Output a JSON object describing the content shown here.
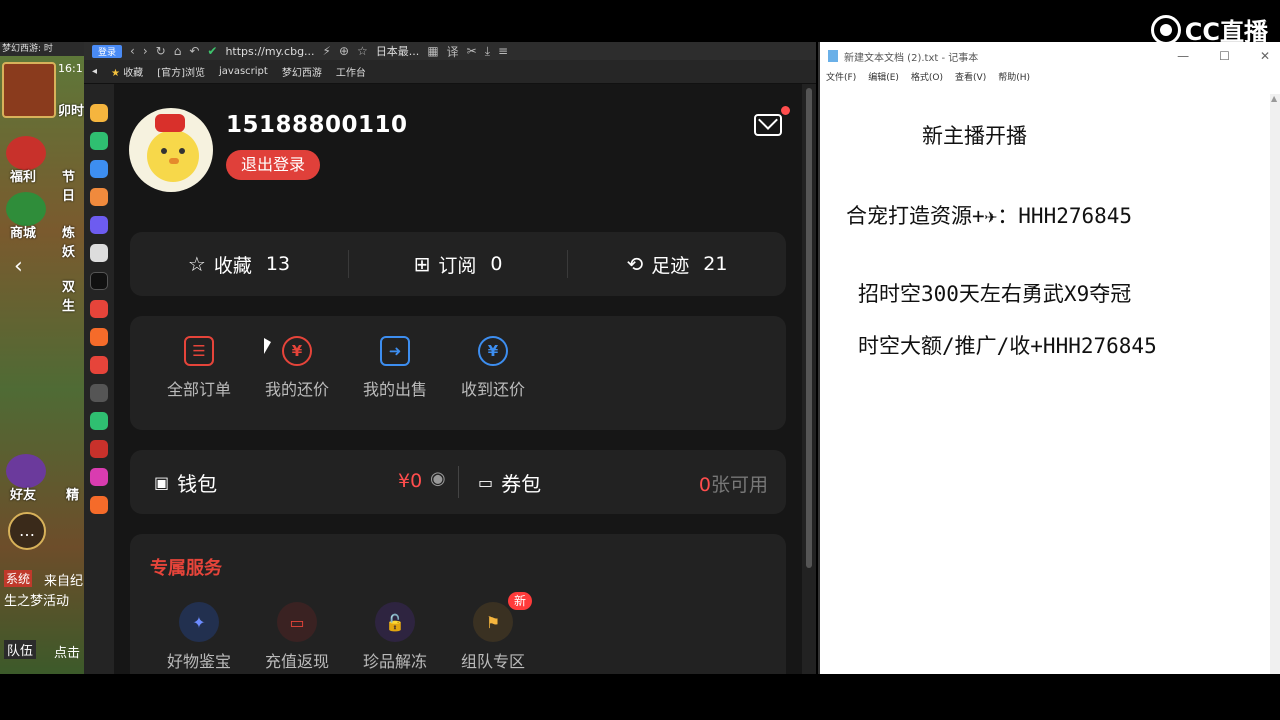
{
  "stream": {
    "logo_text": "CC直播"
  },
  "game": {
    "window_title": "梦幻西游: 时",
    "time": "16:1",
    "labels": [
      {
        "text": "卯时"
      },
      {
        "text": "福利"
      },
      {
        "text": "节日"
      },
      {
        "text": "商城"
      },
      {
        "text": "炼妖"
      },
      {
        "text": "双生"
      },
      {
        "text": "好友"
      },
      {
        "text": "精"
      }
    ],
    "system_chip": "系统",
    "system_text": "来自纪",
    "system_text2": "生之梦活动",
    "team_label": "队伍",
    "team_text": "点击"
  },
  "browser": {
    "login_badge": "登录",
    "url": "https://my.cbg...",
    "tab_text": "日本最...",
    "bookmarks": [
      "收藏",
      "[官方]浏览",
      "javascript",
      "梦幻西游",
      "工作台"
    ],
    "page": {
      "username": "15188800110",
      "logout_label": "退出登录",
      "stats": [
        {
          "label": "收藏",
          "count": "13",
          "icon": "star-icon"
        },
        {
          "label": "订阅",
          "count": "0",
          "icon": "subscribe-icon"
        },
        {
          "label": "足迹",
          "count": "21",
          "icon": "footprint-icon"
        }
      ],
      "orders": [
        {
          "label": "全部订单",
          "glyph": "☰",
          "color": "#e6443a"
        },
        {
          "label": "我的还价",
          "glyph": "¥",
          "color": "#e6443a"
        },
        {
          "label": "我的出售",
          "glyph": "➜",
          "color": "#3d8ef0"
        },
        {
          "label": "收到还价",
          "glyph": "¥",
          "color": "#3d8ef0"
        }
      ],
      "wallet": {
        "label": "钱包",
        "amount": "¥0",
        "coupon_label": "券包",
        "coupon_zero": "0",
        "coupon_text": "张可用"
      },
      "services_title": "专属服务",
      "services": [
        {
          "label": "好物鉴宝",
          "bg": "#22304f",
          "fg": "#6d8cff",
          "glyph": "✦"
        },
        {
          "label": "充值返现",
          "bg": "#3a2222",
          "fg": "#e6443a",
          "glyph": "▭"
        },
        {
          "label": "珍品解冻",
          "bg": "#2e2440",
          "fg": "#9b6bf0",
          "glyph": "🔓"
        },
        {
          "label": "组队专区",
          "bg": "#3a3122",
          "fg": "#f5b53e",
          "glyph": "⚑",
          "badge": "新"
        }
      ]
    }
  },
  "notepad": {
    "title": "新建文本文档 (2).txt - 记事本",
    "menu": [
      "文件(F)",
      "编辑(E)",
      "格式(O)",
      "查看(V)",
      "帮助(H)"
    ],
    "lines": [
      {
        "text": "新主播开播"
      },
      {
        "text": "合宠打造资源+✈：HHH276845"
      },
      {
        "text": "招时空300天左右勇武X9夺冠"
      },
      {
        "text": "时空大额/推广/收+HHH276845"
      }
    ]
  }
}
